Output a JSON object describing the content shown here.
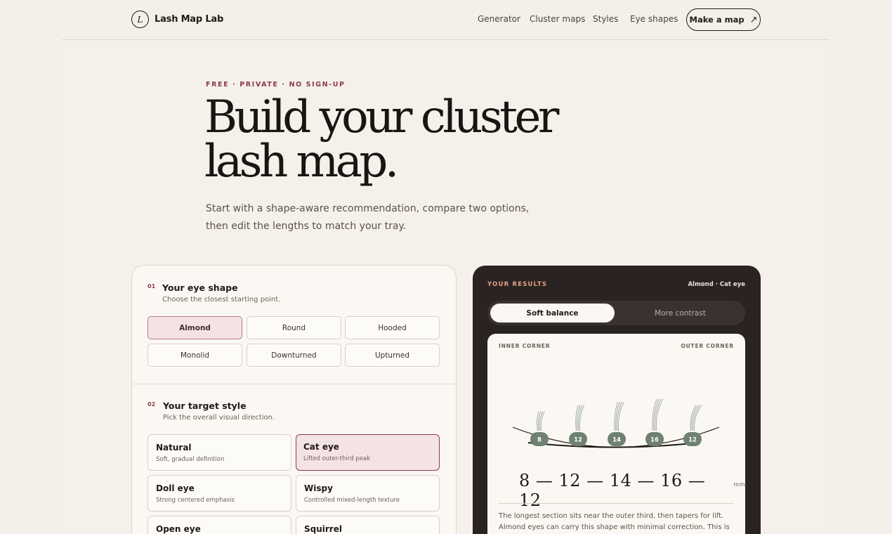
{
  "header": {
    "logo_letter": "L",
    "brand": "Lash Map Lab",
    "nav": [
      "Generator",
      "Cluster maps",
      "Styles",
      "Eye shapes"
    ],
    "cta_label": "Make a map",
    "cta_icon": "arrow-up-right-icon"
  },
  "hero": {
    "eyebrow": "FREE · PRIVATE · NO SIGN-UP",
    "headline_line1": "Build your cluster",
    "headline_line2": "lash map.",
    "subhead": "Start with a shape-aware recommendation, compare two options, then edit the lengths to match your tray."
  },
  "eye_shape": {
    "number": "01",
    "title": "Your eye shape",
    "subtitle": "Choose the closest starting point.",
    "options": [
      "Almond",
      "Round",
      "Hooded",
      "Monolid",
      "Downturned",
      "Upturned"
    ],
    "selected": "Almond"
  },
  "target_style": {
    "number": "02",
    "title": "Your target style",
    "subtitle": "Pick the overall visual direction.",
    "options": [
      {
        "name": "Natural",
        "desc": "Soft, gradual definition"
      },
      {
        "name": "Cat eye",
        "desc": "Lifted outer-third peak"
      },
      {
        "name": "Doll eye",
        "desc": "Strong centered emphasis"
      },
      {
        "name": "Wispy",
        "desc": "Controlled mixed-length texture"
      },
      {
        "name": "Open eye",
        "desc": ""
      },
      {
        "name": "Squirrel",
        "desc": ""
      }
    ],
    "selected": "Cat eye"
  },
  "results": {
    "label": "YOUR RESULTS",
    "meta": "Almond · Cat eye",
    "toggle": [
      "Soft balance",
      "More contrast"
    ],
    "active_toggle": "Soft balance",
    "inner_label": "INNER CORNER",
    "outer_label": "OUTER CORNER",
    "lengths": [
      "8",
      "12",
      "14",
      "16",
      "12"
    ],
    "length_text": "8 — 12 — 14 — 16 — 12",
    "unit": "mm",
    "note": "The longest section sits near the outer third, then tapers for lift. Almond eyes can carry this shape with minimal correction. This is the softer option."
  },
  "colors": {
    "accent": "#8c3a4c",
    "dark_card": "#2a2322",
    "badge": "#6f8170",
    "results_label": "#e0a080"
  }
}
